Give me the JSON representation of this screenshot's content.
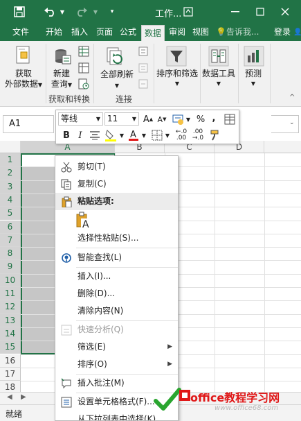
{
  "titlebar": {
    "title": "工作..."
  },
  "tabs": [
    {
      "label": "文件"
    },
    {
      "label": "开始"
    },
    {
      "label": "插入"
    },
    {
      "label": "页面"
    },
    {
      "label": "公式"
    },
    {
      "label": "数据"
    },
    {
      "label": "审阅"
    },
    {
      "label": "视图"
    },
    {
      "label": "告诉我..."
    },
    {
      "label": "登录"
    }
  ],
  "active_tab": "数据",
  "ribbon": {
    "get_data": "获取\n外部数据",
    "new_query": "新建\n查询",
    "refresh_all": "全部刷新",
    "sort_filter": "排序和筛选",
    "data_tools": "数据工具",
    "forecast": "预测",
    "group_get_transform": "获取和转换",
    "group_connections": "连接"
  },
  "namebox": {
    "value": "A1"
  },
  "columns": [
    "A",
    "B",
    "C",
    "D"
  ],
  "rows": [
    "1",
    "2",
    "3",
    "4",
    "5",
    "6",
    "7",
    "8",
    "9",
    "10",
    "11",
    "12",
    "13",
    "14",
    "15",
    "16",
    "17",
    "18"
  ],
  "selected_rows": 15,
  "minitoolbar": {
    "font": "等线",
    "size": "11",
    "bold": "B",
    "italic": "I",
    "percent": "%",
    "comma": ","
  },
  "context_menu": {
    "cut": "剪切(T)",
    "copy": "复制(C)",
    "paste_options": "粘贴选项:",
    "paste_special": "选择性粘贴(S)...",
    "smart_lookup": "智能查找(L)",
    "insert": "插入(I)...",
    "delete": "删除(D)...",
    "clear": "清除内容(N)",
    "quick_analysis": "快速分析(Q)",
    "filter": "筛选(E)",
    "sort": "排序(O)",
    "insert_comment": "插入批注(M)",
    "format_cells": "设置单元格格式(F)...",
    "pick_from_list": "从下拉列表中选择(K)..."
  },
  "statusbar": {
    "ready": "就绪"
  },
  "watermark": {
    "line1": "office教程学习网",
    "line2": "www.office68.com"
  },
  "colors": {
    "excel_green": "#217346",
    "watermark_red": "#e01818"
  }
}
